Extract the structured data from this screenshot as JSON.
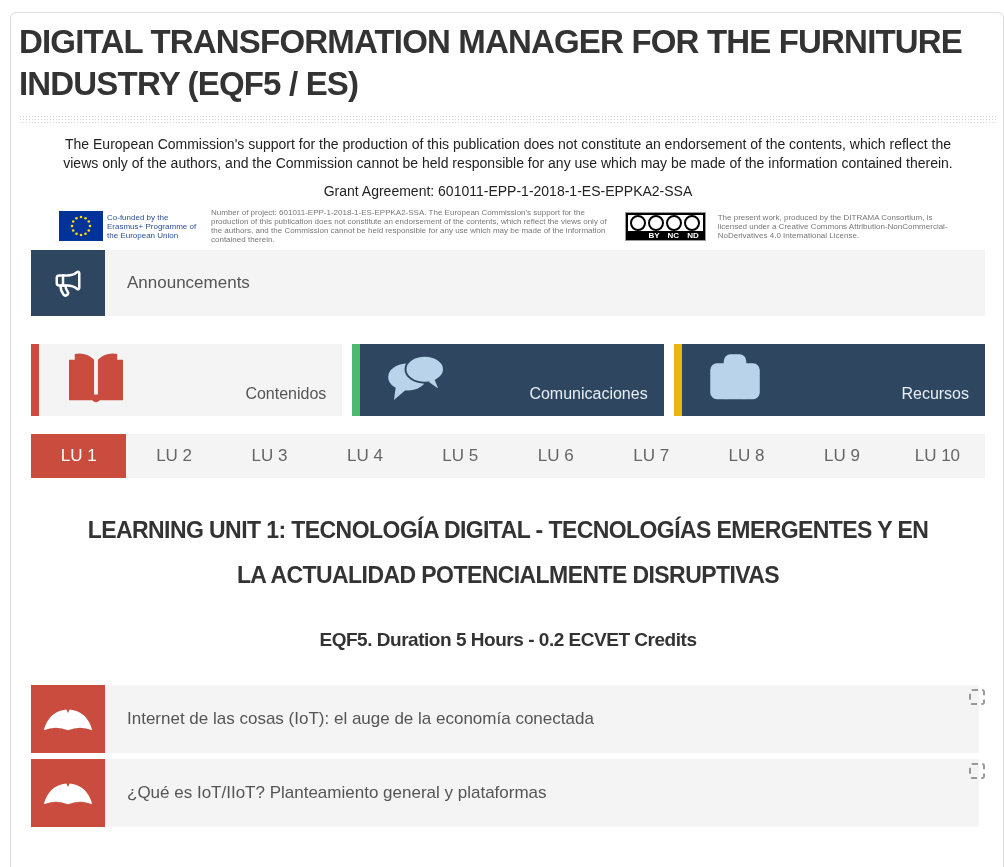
{
  "title": "DIGITAL TRANSFORMATION MANAGER FOR THE FURNITURE INDUSTRY (EQF5 / ES)",
  "disclaimer": "The European Commission's support for the production of this publication does not constitute an endorsement of the contents, which reflect the views only of the authors, and the Commission cannot be held responsible for any use which may be made of the information contained therein.",
  "grant": "Grant Agreement: 601011-EPP-1-2018-1-ES-EPPKA2-SSA",
  "logos": {
    "erasmus": "Co-funded by the Erasmus+ Programme of the European Union",
    "project_note": "Number of project: 601011-EPP-1-2018-1-ES-EPPKA2-SSA. The European Commission's support for the production of this publication does not constitute an endorsement of the contents, which reflect the views only of the authors, and the Commission cannot be held responsible for any use which may be made of the information contained therein.",
    "cc_labels": [
      "BY",
      "NC",
      "ND"
    ],
    "license": "The present work, produced by the DITRAMA Consortium, is licensed under a Creative Commons Attribution-NonCommercial-NoDerivatives 4.0 International License."
  },
  "announcements": {
    "label": "Announcements"
  },
  "tiles": [
    {
      "label": "Contenidos",
      "kind": "book",
      "color": "#c94c3e",
      "selected": true
    },
    {
      "label": "Comunicaciones",
      "kind": "chat",
      "color": "#4cb870",
      "selected": false
    },
    {
      "label": "Recursos",
      "kind": "briefcase",
      "color": "#e8b70e",
      "selected": false
    }
  ],
  "tabs": [
    {
      "label": "LU 1",
      "selected": true
    },
    {
      "label": "LU 2",
      "selected": false
    },
    {
      "label": "LU 3",
      "selected": false
    },
    {
      "label": "LU 4",
      "selected": false
    },
    {
      "label": "LU 5",
      "selected": false
    },
    {
      "label": "LU 6",
      "selected": false
    },
    {
      "label": "LU 7",
      "selected": false
    },
    {
      "label": "LU 8",
      "selected": false
    },
    {
      "label": "LU 9",
      "selected": false
    },
    {
      "label": "LU 10",
      "selected": false
    }
  ],
  "unit_title": "LEARNING UNIT 1: TECNOLOGÍA DIGITAL - TECNOLOGÍAS EMERGENTES Y EN LA ACTUALIDAD POTENCIALMENTE DISRUPTIVAS",
  "unit_subtitle": "EQF5. Duration 5 Hours - 0.2 ECVET Credits",
  "activities": [
    {
      "label": "Internet de las cosas (IoT): el auge de la economía conectada",
      "checked": false
    },
    {
      "label": "¿Qué es IoT/IIoT? Planteamiento general y plataformas",
      "checked": false
    }
  ]
}
